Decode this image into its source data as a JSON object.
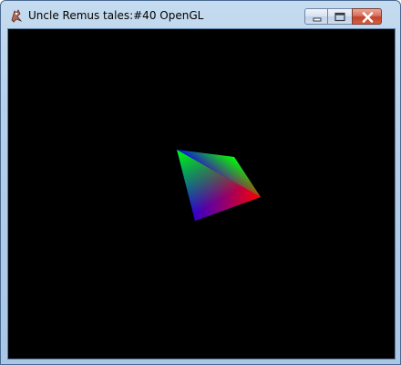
{
  "window": {
    "title": "Uncle Remus tales:#40 OpenGL",
    "app_icon": "app-icon",
    "buttons": {
      "minimize_icon": "minimize-icon",
      "maximize_icon": "maximize-icon",
      "close_icon": "close-icon"
    }
  },
  "viewport": {
    "background": "#000000",
    "vertex_colors": [
      "#0000ff",
      "#00ff00",
      "#ff0000"
    ]
  }
}
